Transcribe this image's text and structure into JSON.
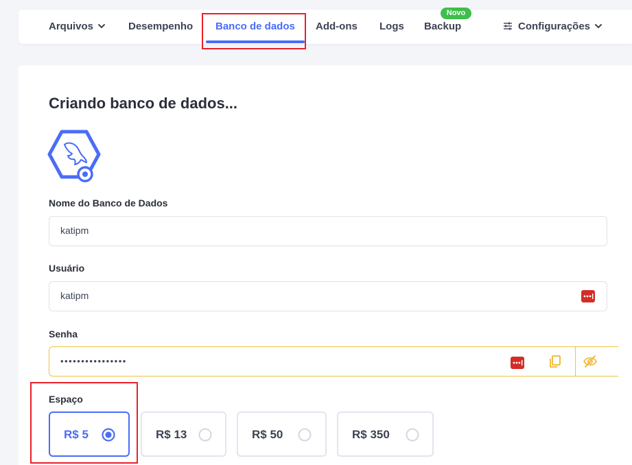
{
  "nav": {
    "items": [
      {
        "id": "arquivos",
        "label": "Arquivos",
        "dropdown": true
      },
      {
        "id": "desempenho",
        "label": "Desempenho"
      },
      {
        "id": "banco",
        "label": "Banco de dados",
        "active": true
      },
      {
        "id": "addons",
        "label": "Add-ons"
      },
      {
        "id": "logs",
        "label": "Logs"
      },
      {
        "id": "backup",
        "label": "Backup",
        "badge": "Novo"
      },
      {
        "id": "config",
        "label": "Configurações",
        "dropdown": true,
        "icon": "sliders-icon"
      }
    ]
  },
  "form": {
    "title": "Criando banco de dados...",
    "db_icon": "mysql-dolphin-icon",
    "name_label": "Nome do Banco de Dados",
    "name_value": "katipm",
    "user_label": "Usuário",
    "user_value": "katipm",
    "password_label": "Senha",
    "password_value": "••••••••••••••••",
    "space_label": "Espaço",
    "space_options": [
      {
        "label": "R$ 5",
        "selected": true
      },
      {
        "label": "R$ 13",
        "selected": false
      },
      {
        "label": "R$ 50",
        "selected": false
      },
      {
        "label": "R$ 350",
        "selected": false
      }
    ]
  },
  "colors": {
    "accent": "#4a6cf7",
    "badge_green": "#3dbf4b",
    "password_border": "#f0c340",
    "highlight_red": "#e8202a",
    "lastpass_red": "#d32d27"
  }
}
